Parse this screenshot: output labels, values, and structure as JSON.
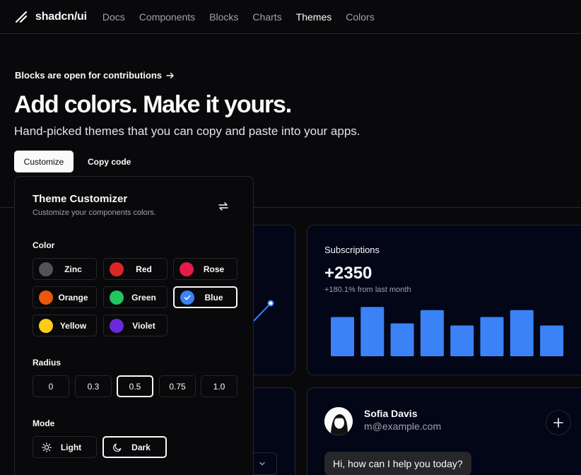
{
  "header": {
    "brand": "shadcn/ui",
    "nav": [
      "Docs",
      "Components",
      "Blocks",
      "Charts",
      "Themes",
      "Colors"
    ],
    "active_nav": "Themes"
  },
  "hero": {
    "announcement": "Blocks are open for contributions",
    "title": "Add colors. Make it yours.",
    "subtitle": "Hand-picked themes that you can copy and paste into your apps.",
    "customize_label": "Customize",
    "copy_label": "Copy code"
  },
  "customizer": {
    "title": "Theme Customizer",
    "description": "Customize your components colors.",
    "color_label": "Color",
    "colors": [
      {
        "name": "Zinc",
        "hex": "#52525b"
      },
      {
        "name": "Red",
        "hex": "#dc2626"
      },
      {
        "name": "Rose",
        "hex": "#e11d48"
      },
      {
        "name": "Orange",
        "hex": "#ea580c"
      },
      {
        "name": "Green",
        "hex": "#22c55e"
      },
      {
        "name": "Blue",
        "hex": "#3b82f6"
      },
      {
        "name": "Yellow",
        "hex": "#facc15"
      },
      {
        "name": "Violet",
        "hex": "#6d28d9"
      }
    ],
    "selected_color": "Blue",
    "radius_label": "Radius",
    "radius_options": [
      "0",
      "0.3",
      "0.5",
      "0.75",
      "1.0"
    ],
    "selected_radius": "0.5",
    "mode_label": "Mode",
    "modes": [
      "Light",
      "Dark"
    ],
    "selected_mode": "Dark"
  },
  "subscriptions": {
    "title": "Subscriptions",
    "value": "+2350",
    "change": "+180.1% from last month",
    "bar_values": [
      0.74,
      0.93,
      0.62,
      0.87,
      0.58,
      0.74,
      0.87,
      0.58
    ],
    "accent": "#3b82f6"
  },
  "chat": {
    "name": "Sofia Davis",
    "email": "m@example.com",
    "message": "Hi, how can I help you today?"
  }
}
